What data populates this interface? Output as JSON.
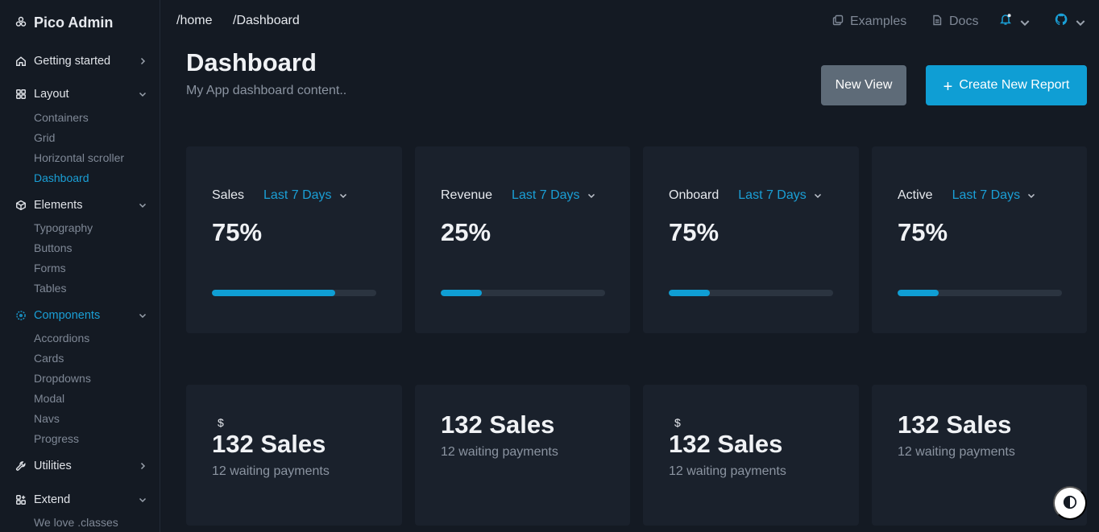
{
  "brand": {
    "name": "Pico Admin",
    "icon": "flower-icon"
  },
  "sidebar": {
    "groups": [
      {
        "label": "Getting started",
        "icon": "home-icon",
        "expanded": false
      },
      {
        "label": "Layout",
        "icon": "grid-icon",
        "expanded": true,
        "items": [
          "Containers",
          "Grid",
          "Horizontal scroller",
          "Dashboard"
        ]
      },
      {
        "label": "Elements",
        "icon": "box-icon",
        "expanded": true,
        "items": [
          "Typography",
          "Buttons",
          "Forms",
          "Tables"
        ]
      },
      {
        "label": "Components",
        "icon": "components-icon",
        "expanded": true,
        "items": [
          "Accordions",
          "Cards",
          "Dropdowns",
          "Modal",
          "Navs",
          "Progress"
        ]
      },
      {
        "label": "Utilities",
        "icon": "wrench-icon",
        "expanded": false
      },
      {
        "label": "Extend",
        "icon": "extend-icon",
        "expanded": true,
        "items": [
          "We love .classes"
        ]
      }
    ],
    "active_item": "Dashboard"
  },
  "topbar": {
    "breadcrumbs": [
      "/home",
      "/Dashboard"
    ],
    "examples_label": "Examples",
    "docs_label": "Docs"
  },
  "header": {
    "title": "Dashboard",
    "subtitle": "My App dashboard content..",
    "new_view_label": "New View",
    "create_report_label": "Create New Report",
    "create_report_icon": "+"
  },
  "stats": [
    {
      "label": "Sales",
      "period": "Last 7 Days",
      "value": "75%",
      "progress": 0.75
    },
    {
      "label": "Revenue",
      "period": "Last 7 Days",
      "value": "25%",
      "progress": 0.25
    },
    {
      "label": "Onboard",
      "period": "Last 7 Days",
      "value": "75%",
      "progress": 0.25
    },
    {
      "label": "Active",
      "period": "Last 7 Days",
      "value": "75%",
      "progress": 0.25
    }
  ],
  "sales_cards": [
    {
      "currency": "$",
      "title": "132 Sales",
      "sub": "12 waiting payments"
    },
    {
      "currency": "",
      "title": "132 Sales",
      "sub": "12 waiting payments"
    },
    {
      "currency": "$",
      "title": "132 Sales",
      "sub": "12 waiting payments"
    },
    {
      "currency": "",
      "title": "132 Sales",
      "sub": "12 waiting payments"
    }
  ],
  "colors": {
    "accent": "#0f9ed4",
    "background": "#141a23",
    "card": "#1a212c",
    "secondary": "#5e6b78"
  }
}
